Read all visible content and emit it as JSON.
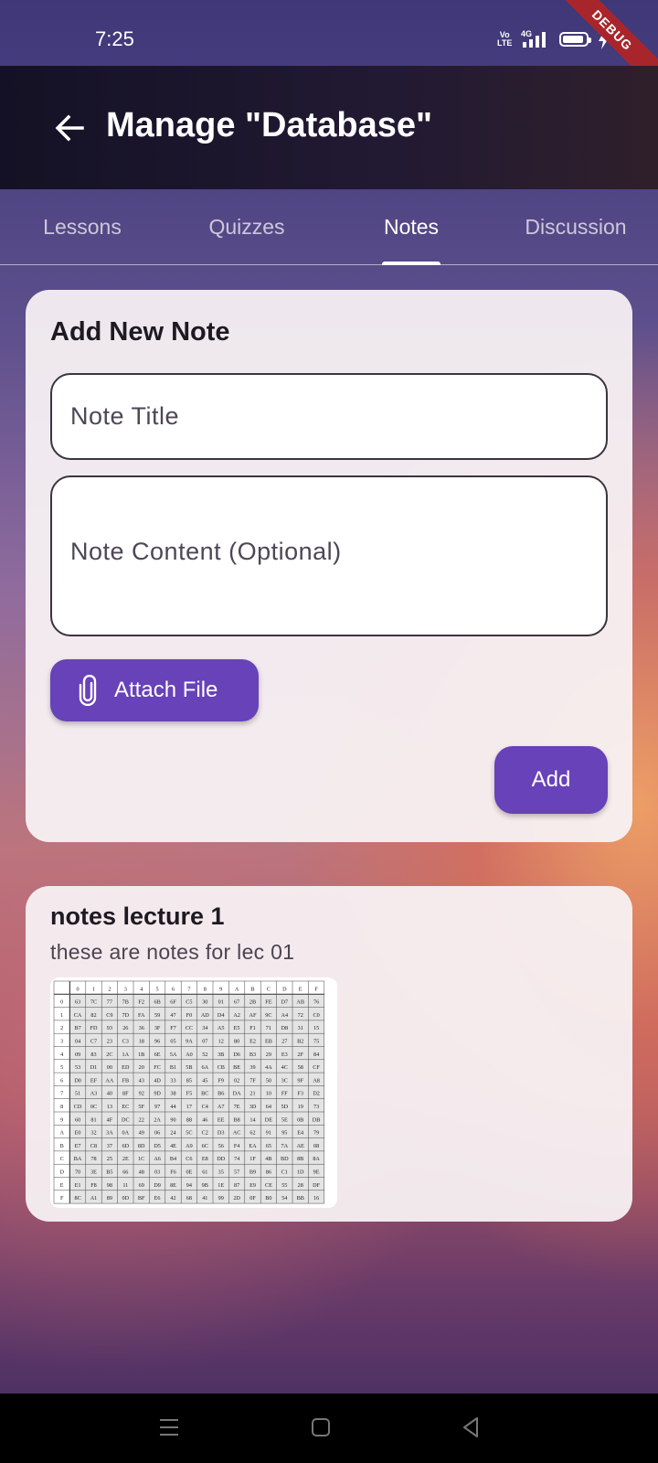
{
  "status_bar": {
    "time": "7:25",
    "volte": "Vo LTE",
    "network": "4G",
    "debug": "DEBUG"
  },
  "app_bar": {
    "title": "Manage \"Database\""
  },
  "tabs": [
    {
      "label": "Lessons"
    },
    {
      "label": "Quizzes"
    },
    {
      "label": "Notes",
      "active": true
    },
    {
      "label": "Discussion"
    }
  ],
  "add_note": {
    "heading": "Add New Note",
    "title_placeholder": "Note Title",
    "title_value": "",
    "content_placeholder": "Note Content (Optional)",
    "content_value": "",
    "attach_label": "Attach File",
    "add_label": "Add"
  },
  "notes": [
    {
      "title": "notes lecture 1",
      "content": "these are notes for lec 01",
      "attachment": {
        "type": "image",
        "col_headers": [
          "0",
          "1",
          "2",
          "3",
          "4",
          "5",
          "6",
          "7",
          "8",
          "9",
          "A",
          "B",
          "C",
          "D",
          "E",
          "F"
        ],
        "rows": [
          {
            "h": "0",
            "c": [
              "63",
              "7C",
              "77",
              "7B",
              "F2",
              "6B",
              "6F",
              "C5",
              "30",
              "01",
              "67",
              "2B",
              "FE",
              "D7",
              "AB",
              "76"
            ]
          },
          {
            "h": "1",
            "c": [
              "CA",
              "82",
              "C9",
              "7D",
              "FA",
              "59",
              "47",
              "F0",
              "AD",
              "D4",
              "A2",
              "AF",
              "9C",
              "A4",
              "72",
              "C0"
            ]
          },
          {
            "h": "2",
            "c": [
              "B7",
              "FD",
              "93",
              "26",
              "36",
              "3F",
              "F7",
              "CC",
              "34",
              "A5",
              "E5",
              "F1",
              "71",
              "D8",
              "31",
              "15"
            ]
          },
          {
            "h": "3",
            "c": [
              "04",
              "C7",
              "23",
              "C3",
              "18",
              "96",
              "05",
              "9A",
              "07",
              "12",
              "80",
              "E2",
              "EB",
              "27",
              "B2",
              "75"
            ]
          },
          {
            "h": "4",
            "c": [
              "09",
              "83",
              "2C",
              "1A",
              "1B",
              "6E",
              "5A",
              "A0",
              "52",
              "3B",
              "D6",
              "B3",
              "29",
              "E3",
              "2F",
              "84"
            ]
          },
          {
            "h": "5",
            "c": [
              "53",
              "D1",
              "00",
              "ED",
              "20",
              "FC",
              "B1",
              "5B",
              "6A",
              "CB",
              "BE",
              "39",
              "4A",
              "4C",
              "58",
              "CF"
            ]
          },
          {
            "h": "6",
            "c": [
              "D0",
              "EF",
              "AA",
              "FB",
              "43",
              "4D",
              "33",
              "85",
              "45",
              "F9",
              "02",
              "7F",
              "50",
              "3C",
              "9F",
              "A8"
            ]
          },
          {
            "h": "7",
            "c": [
              "51",
              "A3",
              "40",
              "8F",
              "92",
              "9D",
              "38",
              "F5",
              "BC",
              "B6",
              "DA",
              "21",
              "10",
              "FF",
              "F3",
              "D2"
            ]
          },
          {
            "h": "8",
            "c": [
              "CD",
              "0C",
              "13",
              "EC",
              "5F",
              "97",
              "44",
              "17",
              "C4",
              "A7",
              "7E",
              "3D",
              "64",
              "5D",
              "19",
              "73"
            ]
          },
          {
            "h": "9",
            "c": [
              "60",
              "81",
              "4F",
              "DC",
              "22",
              "2A",
              "90",
              "88",
              "46",
              "EE",
              "B8",
              "14",
              "DE",
              "5E",
              "0B",
              "DB"
            ]
          },
          {
            "h": "A",
            "c": [
              "E0",
              "32",
              "3A",
              "0A",
              "49",
              "06",
              "24",
              "5C",
              "C2",
              "D3",
              "AC",
              "62",
              "91",
              "95",
              "E4",
              "79"
            ]
          },
          {
            "h": "B",
            "c": [
              "E7",
              "C8",
              "37",
              "6D",
              "8D",
              "D5",
              "4E",
              "A9",
              "6C",
              "56",
              "F4",
              "EA",
              "65",
              "7A",
              "AE",
              "08"
            ]
          },
          {
            "h": "C",
            "c": [
              "BA",
              "78",
              "25",
              "2E",
              "1C",
              "A6",
              "B4",
              "C6",
              "E8",
              "DD",
              "74",
              "1F",
              "4B",
              "BD",
              "8B",
              "8A"
            ]
          },
          {
            "h": "D",
            "c": [
              "70",
              "3E",
              "B5",
              "66",
              "48",
              "03",
              "F6",
              "0E",
              "61",
              "35",
              "57",
              "B9",
              "86",
              "C1",
              "1D",
              "9E"
            ]
          },
          {
            "h": "E",
            "c": [
              "E1",
              "F8",
              "98",
              "11",
              "69",
              "D9",
              "8E",
              "94",
              "9B",
              "1E",
              "87",
              "E9",
              "CE",
              "55",
              "28",
              "DF"
            ]
          },
          {
            "h": "F",
            "c": [
              "8C",
              "A1",
              "89",
              "0D",
              "BF",
              "E6",
              "42",
              "68",
              "41",
              "99",
              "2D",
              "0F",
              "B0",
              "54",
              "BB",
              "16"
            ]
          }
        ]
      }
    }
  ],
  "colors": {
    "accent": "#6842b8",
    "card": "#f8f2f4",
    "app_bar": "#1a1528"
  }
}
